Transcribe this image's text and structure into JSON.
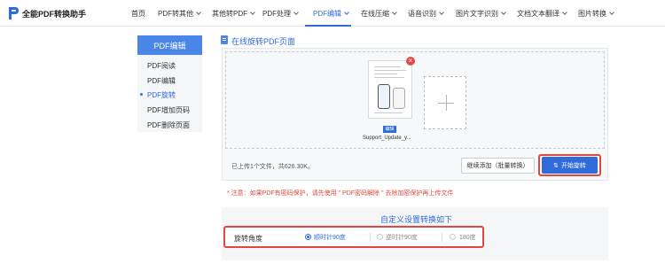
{
  "brand": {
    "name": "全能PDF转换助手",
    "icon": "logo-p-icon",
    "color": "#2f6bd9"
  },
  "nav": {
    "items": [
      {
        "label": "首页",
        "has_dropdown": false,
        "active": false
      },
      {
        "label": "PDF转其他",
        "has_dropdown": true,
        "active": false
      },
      {
        "label": "其他转PDF",
        "has_dropdown": true,
        "active": false
      },
      {
        "label": "PDF处理",
        "has_dropdown": true,
        "active": false
      },
      {
        "label": "PDF编辑",
        "has_dropdown": true,
        "active": true
      },
      {
        "label": "在线压缩",
        "has_dropdown": true,
        "active": false
      },
      {
        "label": "语音识别",
        "has_dropdown": true,
        "active": false
      },
      {
        "label": "图片文字识别",
        "has_dropdown": true,
        "active": false
      },
      {
        "label": "文档文本翻译",
        "has_dropdown": true,
        "active": false
      },
      {
        "label": "图片转换",
        "has_dropdown": true,
        "active": false
      }
    ]
  },
  "sidebar": {
    "heading": "PDF编辑",
    "items": [
      {
        "label": "PDF阅读",
        "active": false
      },
      {
        "label": "PDF编辑",
        "active": false
      },
      {
        "label": "PDF旋转",
        "active": true
      },
      {
        "label": "PDF增加页码",
        "active": false
      },
      {
        "label": "PDF删除页面",
        "active": false
      }
    ]
  },
  "main": {
    "title": "在线旋转PDF页面",
    "file": {
      "name": "Support_Update_y...",
      "tag": "编辑"
    },
    "upload_info": "已上传1个文件，共626.30K。",
    "continue_button": "继续添加（批量转换）",
    "start_button": "开始旋转",
    "notice": "* 注意：如果PDF有密码保护，请先使用 \" PDF密码解除 \" 去除加密保护再上传文件"
  },
  "settings": {
    "title": "自定义设置转换如下",
    "label": "旋转角度",
    "options": [
      {
        "label": "顺时针90度",
        "checked": true
      },
      {
        "label": "逆时针90度",
        "checked": false
      },
      {
        "label": "180度",
        "checked": false
      }
    ]
  },
  "colors": {
    "accent": "#2f6bd9",
    "highlight": "#e0473f",
    "sidebar_head": "#4a86e8"
  }
}
